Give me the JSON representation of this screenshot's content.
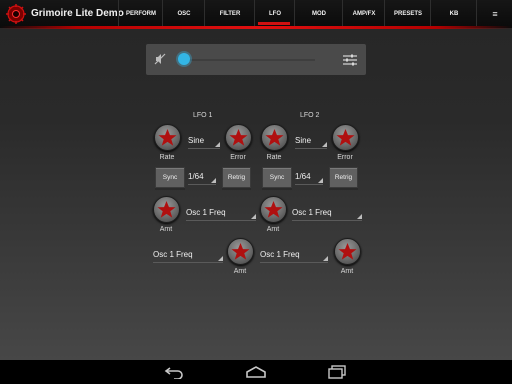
{
  "app": {
    "title": "Grimoire Lite Demo"
  },
  "tabs": {
    "perform": "PERFORM",
    "osc": "OSC",
    "filter": "FILTER",
    "lfo": "LFO",
    "mod": "MOD",
    "ampfx": "AMP/FX",
    "presets": "PRESETS",
    "kb": "KB",
    "more": "≡"
  },
  "slider": {
    "value_fraction": 0.0
  },
  "colors": {
    "accent": "#d01010",
    "slider": "#33b5e5",
    "knob_star": "#b01010"
  },
  "lfo1": {
    "title": "LFO 1",
    "rate_label": "Rate",
    "waveform": "Sine",
    "error_label": "Error",
    "sync": "Sync",
    "division": "1/64",
    "retrig": "Retrig",
    "amt_label": "Amt",
    "dest1": "Osc 1 Freq",
    "dest2": "Osc 1 Freq",
    "amt2_label": "Amt"
  },
  "lfo2": {
    "title": "LFO 2",
    "rate_label": "Rate",
    "waveform": "Sine",
    "error_label": "Error",
    "sync": "Sync",
    "division": "1/64",
    "retrig": "Retrig",
    "amt_label": "Amt",
    "dest1": "Osc 1 Freq",
    "dest2": "Osc 1 Freq",
    "amt2_label": "Amt"
  },
  "icons": {
    "logo": "gear-logo-icon",
    "mute": "mute-icon",
    "settings": "sliders-icon",
    "knob": "star-icon",
    "back": "back-icon",
    "home": "home-icon",
    "recents": "recents-icon"
  }
}
